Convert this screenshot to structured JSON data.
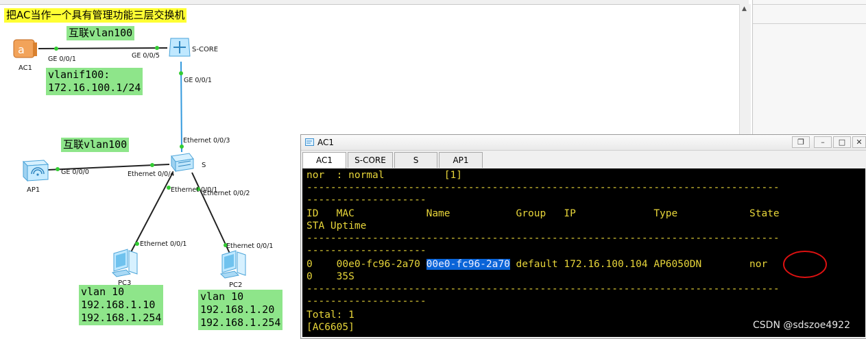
{
  "topology": {
    "title_note": "把AC当作一个具有管理功能三层交换机",
    "notes": {
      "vlan100_top": "互联vlan100",
      "vlanif_line1": "vlanif100:",
      "vlanif_line2": "172.16.100.1/24",
      "vlan100_mid": "互联vlan100",
      "pc3_line1": "vlan 10",
      "pc3_line2": "192.168.1.10",
      "pc3_line3": "192.168.1.254",
      "pc2_line1": "vlan 10",
      "pc2_line2": "192.168.1.20",
      "pc2_line3": "192.168.1.254"
    },
    "devices": {
      "ac1": "AC1",
      "score": "S-CORE",
      "s": "S",
      "ap1": "AP1",
      "pc3": "PC3",
      "pc2": "PC2"
    },
    "ports": {
      "ac1_ge": "GE 0/0/1",
      "score_ge5": "GE 0/0/5",
      "score_ge1": "GE 0/0/1",
      "s_eth3": "Ethernet 0/0/3",
      "ap1_ge": "GE 0/0/0",
      "s_eth4": "Ethernet 0/0/4",
      "s_eth1": "Ethernet 0/0/1",
      "s_eth2": "Ethernet 0/0/2",
      "pc3_eth": "Ethernet 0/0/1",
      "pc2_eth": "Ethernet 0/0/1"
    },
    "colors": {
      "note_green": "#8ee58a",
      "note_yellow": "#ffff33",
      "link_black": "#222222",
      "link_blue": "#3399dd",
      "port_dot": "#33cc33"
    }
  },
  "terminal_window": {
    "title": "AC1",
    "tabs": [
      {
        "label": "AC1",
        "active": true
      },
      {
        "label": "S-CORE",
        "active": false
      },
      {
        "label": "S",
        "active": false
      },
      {
        "label": "AP1",
        "active": false
      }
    ],
    "controls": {
      "restore": "❐",
      "minimize": "–",
      "maximize": "□",
      "close": "✕"
    },
    "lines": {
      "l0": "nor  : normal          [1]",
      "l1": "-------------------------------------------------------------------------------",
      "l2": "--------------------",
      "l3": "ID   MAC            Name           Group   IP             Type            State",
      "l4": "STA Uptime",
      "l5": "-------------------------------------------------------------------------------",
      "l6": "--------------------",
      "l7_pre": "0    00e0-fc96-2a70 ",
      "l7_hl": "00e0-fc96-2a70",
      "l7_post": " default 172.16.100.104 AP6050DN        nor",
      "l8": "0    35S",
      "l9": "-------------------------------------------------------------------------------",
      "l10": "--------------------",
      "l11": "Total: 1",
      "l12": "[AC6605]"
    },
    "colors": {
      "background": "#000000",
      "text": "#e8d63a",
      "highlight": "#0a64d8",
      "annotation_circle": "#dd1111"
    }
  },
  "watermark": "CSDN @sdszoe4922"
}
